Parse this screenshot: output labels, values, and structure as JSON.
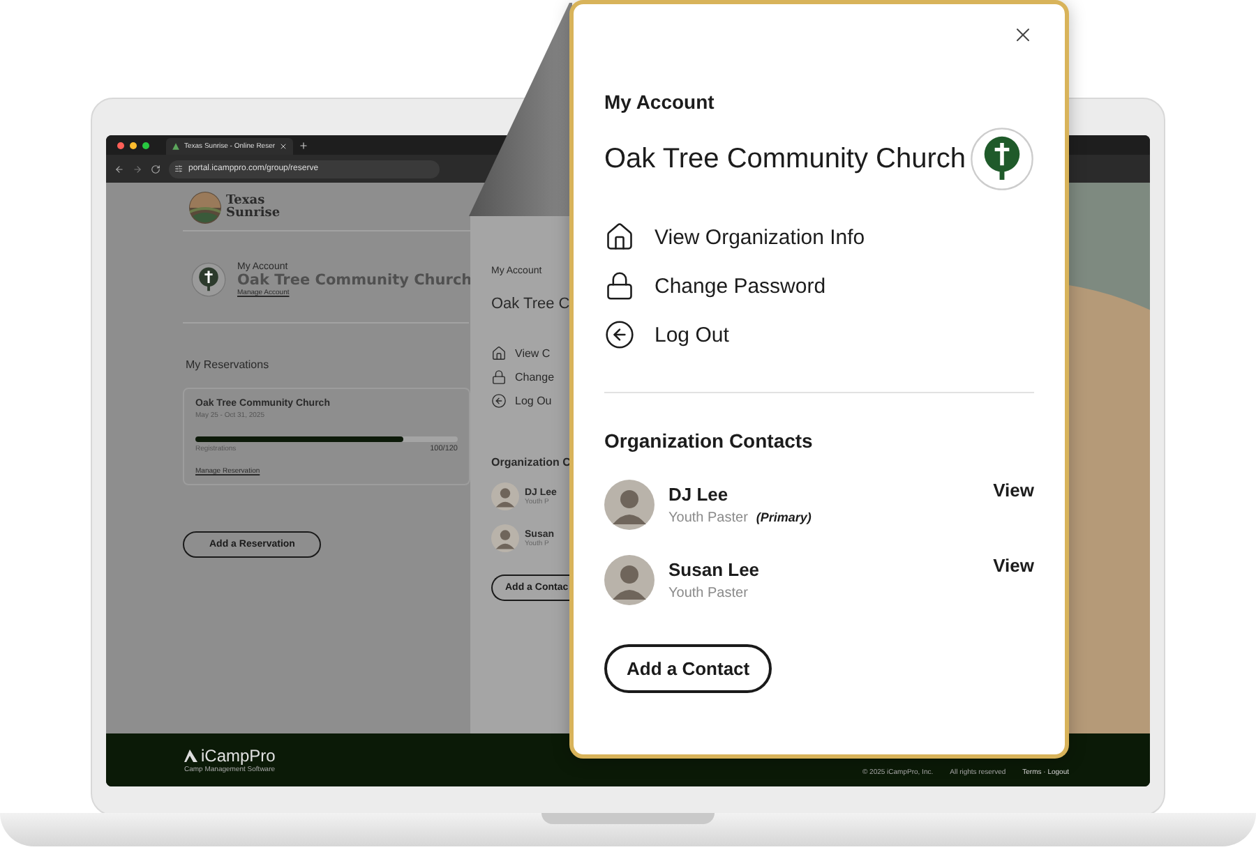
{
  "browser": {
    "tab_title": "Texas Sunrise - Online Reser",
    "url": "portal.icamppro.com/group/reserve"
  },
  "site": {
    "logo_text": "Texas Sunrise",
    "account_label": "My Account",
    "org_name": "Oak Tree Community Church",
    "manage_link": "Manage Account",
    "reservations_heading": "My Reservations",
    "reservation": {
      "name": "Oak Tree Community Church",
      "dates": "May 25 - Oct 31, 2025",
      "level": 0.79,
      "meter_label": "Registrations",
      "reading": "100/120",
      "link": "Manage Reservation"
    },
    "add_button": "Add a Reservation"
  },
  "background_panel": {
    "heading": "My Account",
    "org_name": "Oak Tree C",
    "menu": [
      "View C",
      "Change",
      "Log Ou"
    ],
    "contacts_heading": "Organization C",
    "contacts": [
      {
        "name": "DJ Lee",
        "role": "Youth P"
      },
      {
        "name": "Susan",
        "role": "Youth P"
      }
    ],
    "add_button": "Add a Contac"
  },
  "footer": {
    "brand": "iCampPro",
    "tagline": "Camp Management Software",
    "copyright": "© 2025 iCampPro, Inc.",
    "rights": "All rights reserved",
    "links": "Terms · Logout"
  },
  "account_card": {
    "heading": "My Account",
    "org_name": "Oak Tree Community Church",
    "menu": [
      "View Organization Info",
      "Change Password",
      "Log Out"
    ],
    "contacts_heading": "Organization Contacts",
    "contacts": [
      {
        "name": "DJ Lee",
        "role": "Youth Paster",
        "note": "(Primary)",
        "action": "View"
      },
      {
        "name": "Susan Lee",
        "role": "Youth Paster",
        "action": "View"
      }
    ],
    "add_button": "Add a Contact"
  }
}
